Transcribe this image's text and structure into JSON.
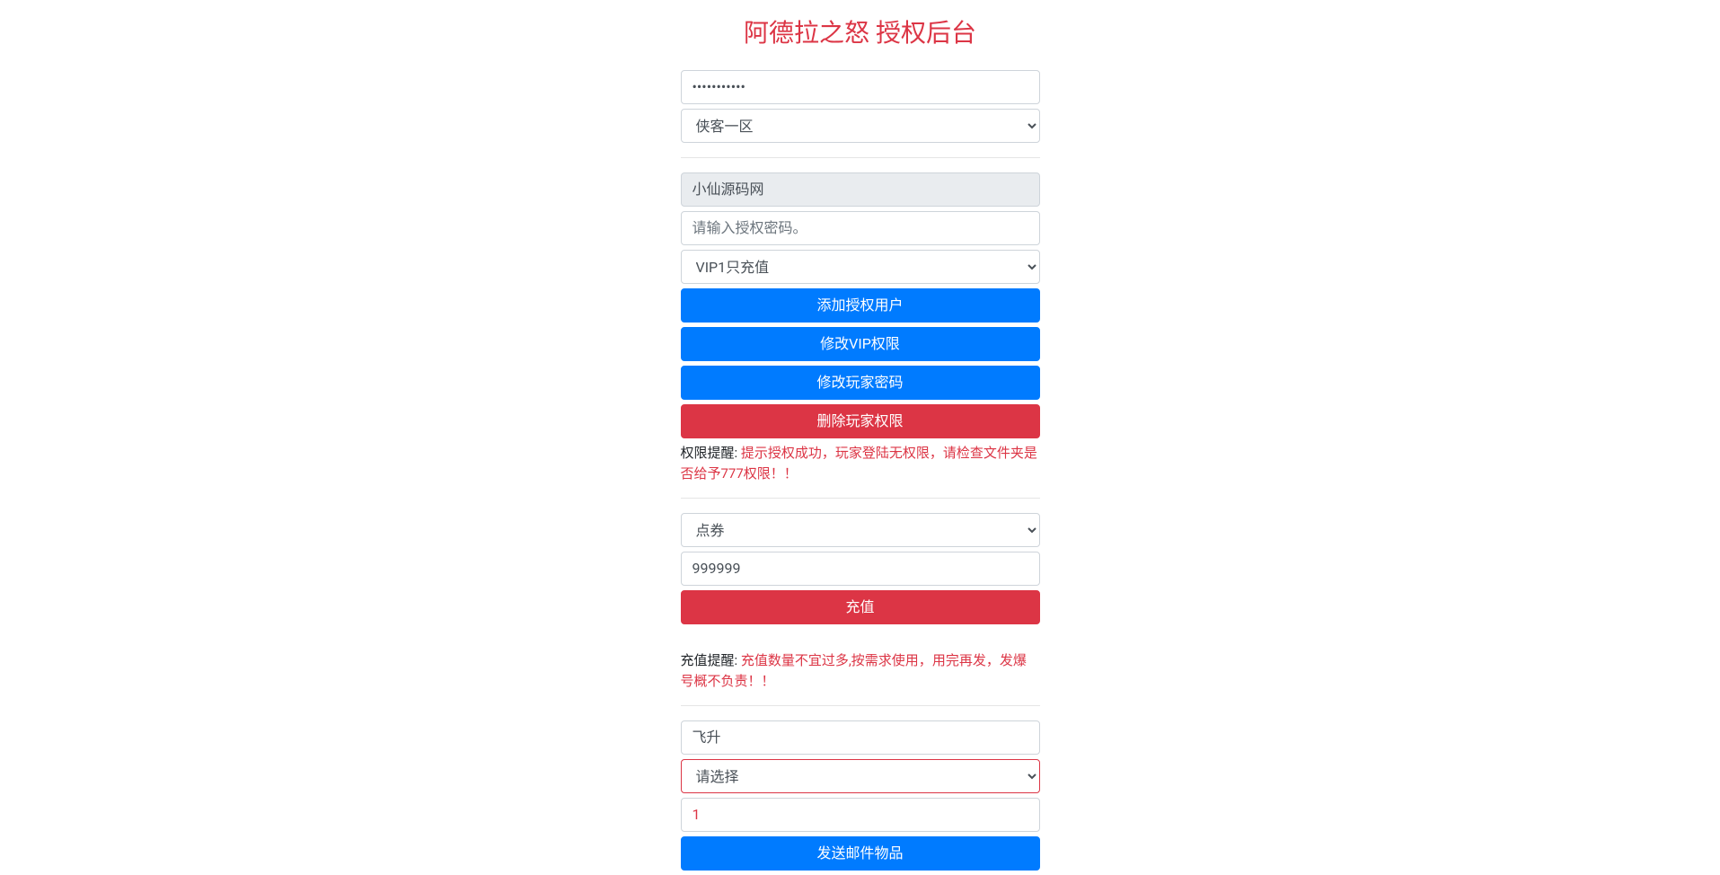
{
  "pageTitle": "阿德拉之怒 授权后台",
  "section1": {
    "passwordValue": "•••••••••••",
    "regionSelected": "侠客一区"
  },
  "section2": {
    "readonlyValue": "小仙源码网",
    "authPasswordPlaceholder": "请输入授权密码。",
    "vipSelected": "VIP1只充值",
    "btnAddAuthUser": "添加授权用户",
    "btnModifyVip": "修改VIP权限",
    "btnModifyPassword": "修改玩家密码",
    "btnDeletePermission": "删除玩家权限",
    "permissionHintLabel": "权限提醒: ",
    "permissionHintText": "提示授权成功，玩家登陆无权限，请检查文件夹是否给予777权限！！"
  },
  "section3": {
    "currencySelected": "点券",
    "amountValue": "999999",
    "btnRecharge": "充值",
    "rechargeHintLabel": "充值提醒: ",
    "rechargeHintText": "充值数量不宜过多,按需求使用，用完再发，发爆号概不负责！！"
  },
  "section4": {
    "itemValue": "飞升",
    "selectPlaceholder": "请选择",
    "quantityValue": "1",
    "btnSendMail": "发送邮件物品"
  }
}
